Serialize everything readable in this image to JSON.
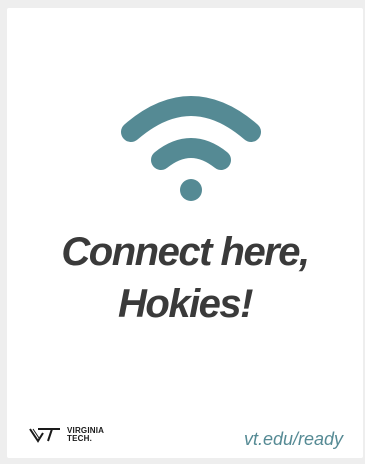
{
  "card": {
    "headline_line1": "Connect here,",
    "headline_line2": "Hokies!",
    "logo": {
      "line1": "VIRGINIA",
      "line2": "TECH."
    },
    "url": "vt.edu/ready"
  },
  "icons": {
    "wifi": "wifi-icon",
    "logo": "vt-logo-icon"
  },
  "colors": {
    "accent": "#558a94",
    "text": "#3a3a3a",
    "background": "#ffffff"
  }
}
